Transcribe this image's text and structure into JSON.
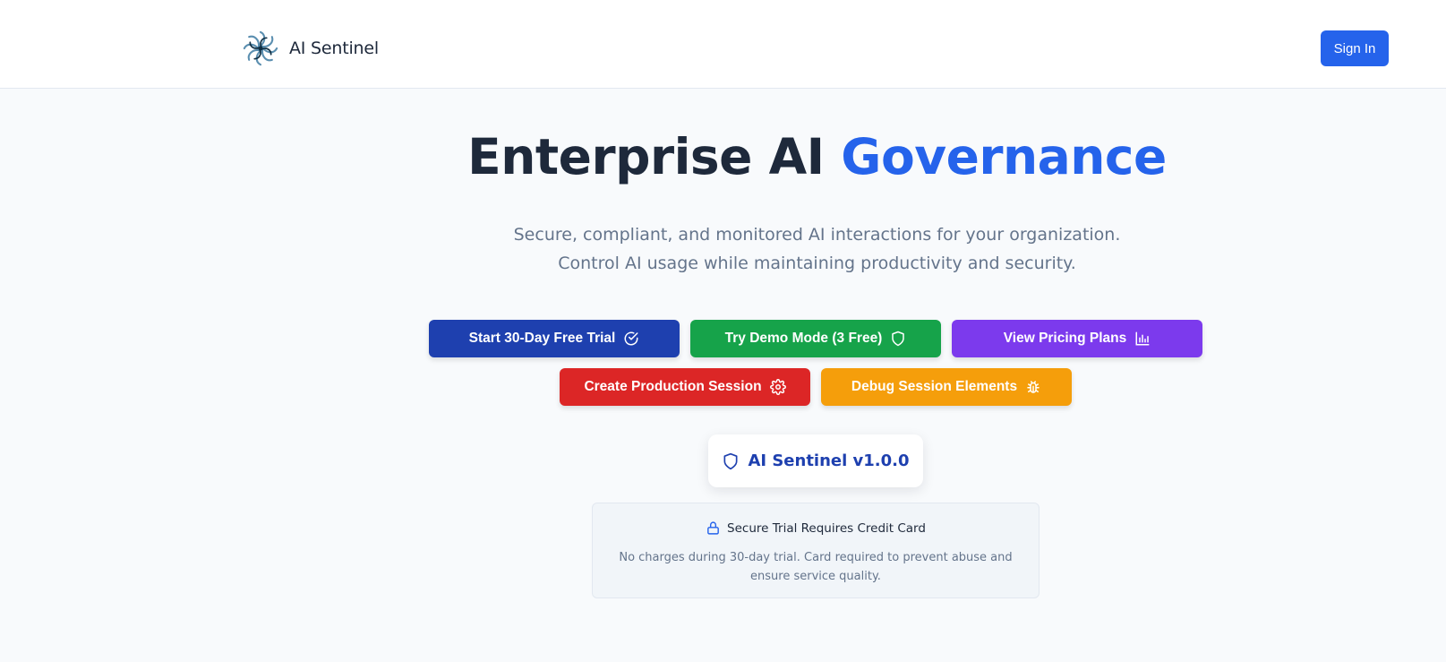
{
  "header": {
    "brand_name": "AI Sentinel",
    "brand_icon": "pinwheel-logo-icon",
    "signin_label": "Sign In"
  },
  "hero": {
    "title_main": "Enterprise AI ",
    "title_accent": "Governance",
    "subtitle": "Secure, compliant, and monitored AI interactions for your organization. Control AI usage while maintaining productivity and security."
  },
  "actions": {
    "trial": {
      "label": "Start 30-Day Free Trial",
      "icon": "check-circle-icon",
      "color": "#1e40af"
    },
    "demo": {
      "label": "Try Demo Mode (3 Free)",
      "icon": "shield-icon",
      "color": "#16a34a"
    },
    "pricing": {
      "label": "View Pricing Plans",
      "icon": "bar-chart-icon",
      "color": "#7c3aed"
    },
    "production": {
      "label": "Create Production Session",
      "icon": "gear-icon",
      "color": "#dc2626"
    },
    "debug": {
      "label": "Debug Session Elements",
      "icon": "bug-icon",
      "color": "#f59e0b"
    }
  },
  "version_badge": {
    "label": "AI Sentinel v1.0.0",
    "icon": "shield-icon"
  },
  "notice": {
    "title": "Secure Trial Requires Credit Card",
    "icon": "lock-icon",
    "body": "No charges during 30-day trial. Card required to prevent abuse and ensure service quality."
  },
  "colors": {
    "primary": "#2563eb",
    "heading": "#1e293b",
    "muted": "#64748b",
    "background": "#f8fafc"
  }
}
